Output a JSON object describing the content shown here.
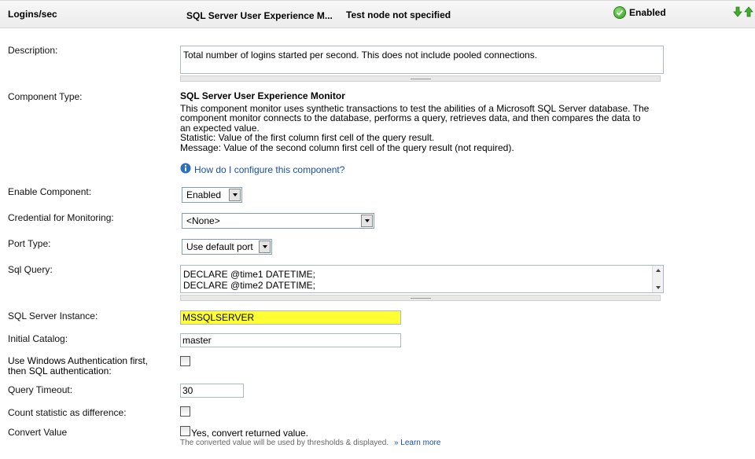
{
  "header": {
    "title": "Logins/sec",
    "component_type": "SQL Server User Experience M...",
    "node": "Test node not specified",
    "status": "Enabled",
    "colors": {
      "enabled_green": "#2f9a1e",
      "header_bg": "#ececec"
    },
    "icons": [
      "check-circle-icon",
      "arrow-down-icon",
      "arrow-up-icon"
    ]
  },
  "description": {
    "label": "Description:",
    "value": "Total number of logins started per second. This does not include pooled connections."
  },
  "component_type": {
    "label": "Component Type:",
    "name": "SQL Server User Experience Monitor",
    "text1": "This component monitor uses synthetic transactions to test the abilities of a Microsoft SQL Server database. The",
    "text2": "component monitor connects to the database, performs a query, retrieves data, and then compares the data to",
    "text3": "an expected value.",
    "statistic": "Statistic: Value of the first column first cell of the query result.",
    "message": "Message: Value of the second column first cell of the query result (not required).",
    "help_link": "How do I configure this component?",
    "help_icon": "info-icon"
  },
  "enable_component": {
    "label": "Enable Component:",
    "value": "Enabled"
  },
  "credential": {
    "label": "Credential for Monitoring:",
    "value": "<None>"
  },
  "port_type": {
    "label": "Port Type:",
    "value": "Use default port"
  },
  "sql_query": {
    "label": "Sql Query:",
    "line1": "DECLARE @time1 DATETIME;",
    "line2": "DECLARE @time2 DATETIME;"
  },
  "sql_instance": {
    "label": "SQL Server Instance:",
    "value": "MSSQLSERVER",
    "highlight": "#ffff33"
  },
  "initial_catalog": {
    "label": "Initial Catalog:",
    "value": "master"
  },
  "windows_auth": {
    "label_line1": "Use Windows Authentication first,",
    "label_line2": "then SQL authentication:",
    "checked": false
  },
  "query_timeout": {
    "label": "Query Timeout:",
    "value": "30"
  },
  "count_statistic": {
    "label": "Count statistic as difference:",
    "checked": false
  },
  "convert_value": {
    "label": "Convert Value",
    "checkbox_label": "Yes, convert returned value.",
    "hint": "The converted value will be used by thresholds & displayed.",
    "learn_more": "» Learn more",
    "checked": false
  }
}
